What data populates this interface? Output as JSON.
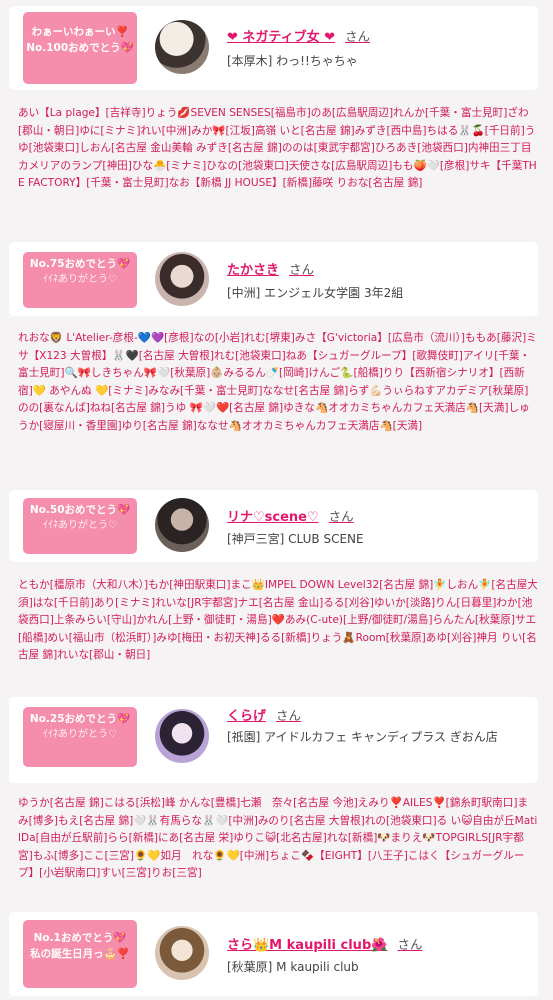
{
  "cards": [
    {
      "badge_line1": "わぁーいわぁーい❣️",
      "badge_line2": "No.100おめでとう💖",
      "name": "❤ ネガティブ女 ❤",
      "san": "さん",
      "shop": "[本厚木] わっ!!ちゃちゃ",
      "avatar_icon": "avatar-photo"
    },
    {
      "badge_line1": "No.75おめでとう💖",
      "badge_line2": "ｲｲﾈありがとう♡",
      "name": "たかさき",
      "san": "さん",
      "shop": "[中洲] エンジェル女学園 3年2組",
      "avatar_icon": "avatar-photo"
    },
    {
      "badge_line1": "No.50おめでとう💖",
      "badge_line2": "ｲｲﾈありがとう♡",
      "name": "リナ♡scene♡",
      "san": "さん",
      "shop": "[神戸三宮] CLUB SCENE",
      "avatar_icon": "avatar-photo"
    },
    {
      "badge_line1": "No.25おめでとう💖",
      "badge_line2": "ｲｲﾈありがとう♡",
      "name": "くらげ",
      "san": "さん",
      "shop": "[祇園] アイドルカフェ キャンディプラス ぎおん店",
      "avatar_icon": "avatar-photo"
    },
    {
      "badge_line1": "No.1おめでとう💖",
      "badge_line2": "私の誕生日月っ🎂❣️",
      "name": "さら👑M kaupili club🌺",
      "san": "さん",
      "shop": "[秋葉原] M kaupili club",
      "avatar_icon": "avatar-photo"
    }
  ],
  "messages": [
    "あい【La plage】[吉祥寺]りょう💋SEVEN SENSES[福島市]のあ[広島駅周辺]れんか[千葉・富士見町]ざわ[郡山・朝日]ゆに[ミナミ]れい[中洲]みか🎀[江坂]高嶺 いと[名古屋 錦]みずき[西中島]ちはる🐰🍒[千日前]うゆ[池袋東口]しおん[名古屋 金山美輪 みずき[名古屋 錦]ののは[東武宇都宮]ひろあき[池袋西口]内神田三丁目 カメリアのランプ[神田]ひな🐣[ミナミ]ひなの[池袋東口]天使さな[広島駅周辺]もも🍑🤍[彦根]サキ【千葉THE FACTORY】[千葉・富士見町]なお【新橋 JJ HOUSE】[新橋]藤咲 りおな[名古屋 錦]",
    "れおな🦁 L'Atelier-彦根-💙💜[彦根]なの[小岩]れむ[堺東]みさ【G'victoria】[広島市（流川）]ももあ[藤沢]ミサ【X123 大曽根】🐰🖤[名古屋 大曽根]れむ[池袋東口]ねあ【シュガーグループ】[歌舞伎町]アイリ[千葉・富士見町]🔍🎀しきちゃん🎀🤍[秋葉原]👶🏼みるるん🍼[岡崎]けんご🐍[船橋]りり【西新宿シナリオ】[西新宿]💛 あやんぬ 💛[ミナミ]みなみ[千葉・富士見町]ななせ[名古屋 錦]らず💪🏻うぃらねすアカデミア[秋葉原]のの[裏なんば]ねね[名古屋 錦]うゆ 🎀🤍❤️[名古屋 錦]ゆきな🐴オオカミちゃんカフェ天満店🐴[天満]しゅうか[寝屋川・香里園]ゆり[名古屋 錦]ななせ🐴オオカミちゃんカフェ天満店🐴[天満]",
    "ともか[橿原市（大和八木）]もか[神田駅東口]まこ👑IMPEL DOWN Level32[名古屋 錦]🧚しおん🧚[名古屋大須]はな[千日前]あり[ミナミ]れいな[JR宇都宮]ナエ[名古屋 金山]るる[刈谷]ゆいか[淡路]りん[日暮里]わか[池袋西口]上条みらい[守山]かれん[上野・御徒町・湯島]❤️あみ(C-ute)[上野/御徒町/湯島]らんたん[秋葉原]サエ[船橋]めい[福山市（松浜町）]みゆ[梅田・お初天神]るる[新橋]りょう🧸Room[秋葉原]あゆ[刈谷]神月 りい[名古屋 錦]れいな[郡山・朝日]",
    "ゆうか[名古屋 錦]こはる[浜松]峰 かんな[豊橋]七瀬　奈々[名古屋 今池]えみり❣️AILES❣️[錦糸町駅南口]まみ[博多]もえ[名古屋 錦]🤍🐰有馬らな🐰🤍[中洲]みのり[名古屋 大曽根]れの[池袋東口]る い😺自由が丘MatilDa[自由が丘駅前]らら[新橋]にあ[名古屋 栄]ゆりこ😺[北名古屋]れな[新橋]🐶まりえ🐶TOPGIRLS[JR宇都宮]もふ[博多]ここ[三宮]🌻💛如月　れな🌻💛[中洲]ちょこ🍫【EIGHT】[八王子]こはく【シュガーグループ】[小岩駅南口]すい[三宮]りお[三宮]"
  ]
}
